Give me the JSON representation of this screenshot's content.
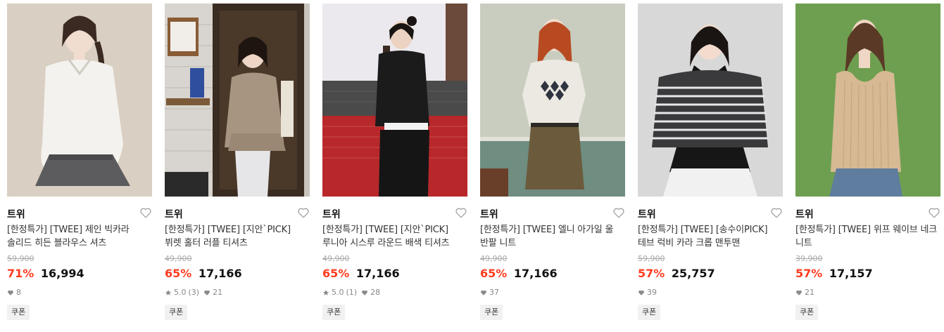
{
  "products": [
    {
      "brand": "트위",
      "title_line1": "[한정특가] [TWEE] 제인 빅카라",
      "title_line2": "솔리드 히든 블라우스 셔츠",
      "original_price": "59,900",
      "discount": "71%",
      "price": "16,994",
      "rating": "",
      "reviews": "",
      "likes": "8",
      "coupon": "쿠폰",
      "bg_color": "#d8cfc3"
    },
    {
      "brand": "트위",
      "title_line1": "[한정특가] [TWEE] [지안`PICK]",
      "title_line2": "뷔렛 홀터 러플 티셔츠",
      "original_price": "49,900",
      "discount": "65%",
      "price": "17,166",
      "rating": "5.0",
      "reviews": "(3)",
      "likes": "21",
      "coupon": "쿠폰",
      "bg_color": "#5a4a3c"
    },
    {
      "brand": "트위",
      "title_line1": "[한정특가] [TWEE] [지안`PICK]",
      "title_line2": "루니아 시스루 라운드 배색 티셔츠",
      "original_price": "49,900",
      "discount": "65%",
      "price": "17,166",
      "rating": "5.0",
      "reviews": "(1)",
      "likes": "28",
      "coupon": "쿠폰",
      "bg_color": "#b52a2a"
    },
    {
      "brand": "트위",
      "title_line1": "[한정특가] [TWEE] 엘니 아가일 울",
      "title_line2": "반팔 니트",
      "original_price": "49,900",
      "discount": "65%",
      "price": "17,166",
      "rating": "",
      "reviews": "",
      "likes": "37",
      "coupon": "쿠폰",
      "bg_color": "#7e9a8c"
    },
    {
      "brand": "트위",
      "title_line1": "[한정특가] [TWEE] [송수이PICK]",
      "title_line2": "테브 럭비 카라 크롭 맨투맨",
      "original_price": "59,900",
      "discount": "57%",
      "price": "25,757",
      "rating": "",
      "reviews": "",
      "likes": "39",
      "coupon": "쿠폰",
      "bg_color": "#d6d6d6"
    },
    {
      "brand": "트위",
      "title_line1": "[한정특가] [TWEE] 위프 웨이브 네크",
      "title_line2": "니트",
      "original_price": "39,900",
      "discount": "57%",
      "price": "17,157",
      "rating": "",
      "reviews": "",
      "likes": "21",
      "coupon": "쿠폰",
      "bg_color": "#6e9e4f"
    }
  ]
}
